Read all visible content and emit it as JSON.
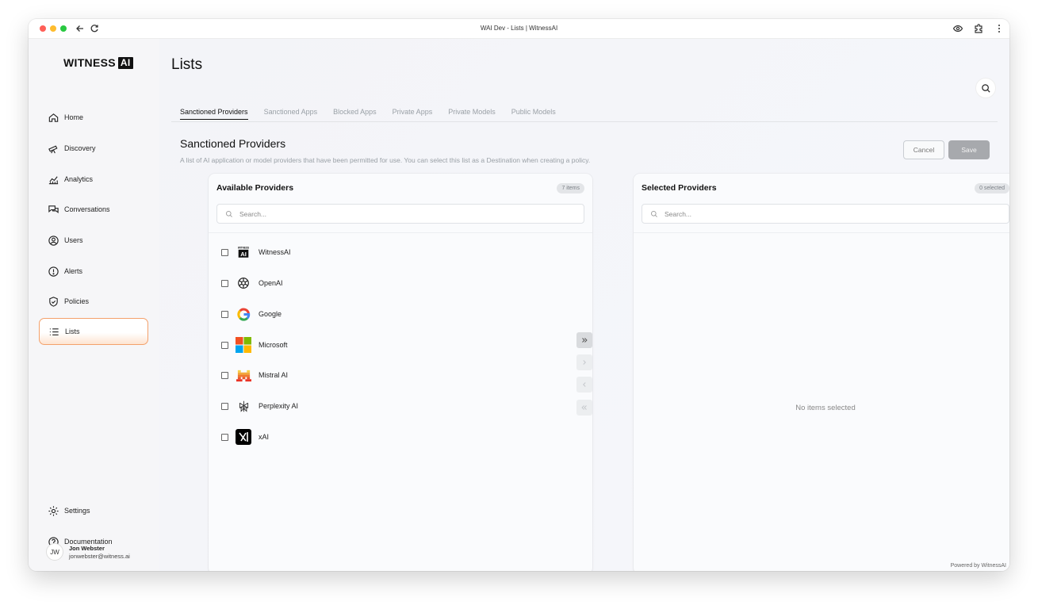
{
  "window": {
    "title": "WAI Dev - Lists | WitnessAI"
  },
  "logo": {
    "text": "WITNESS",
    "box": "AI"
  },
  "sidebar": {
    "items": [
      {
        "label": "Home",
        "icon": "home-icon"
      },
      {
        "label": "Discovery",
        "icon": "telescope-icon"
      },
      {
        "label": "Analytics",
        "icon": "chart-icon"
      },
      {
        "label": "Conversations",
        "icon": "chat-icon"
      },
      {
        "label": "Users",
        "icon": "user-icon"
      },
      {
        "label": "Alerts",
        "icon": "alert-icon"
      },
      {
        "label": "Policies",
        "icon": "shield-icon"
      },
      {
        "label": "Lists",
        "icon": "list-icon",
        "active": true
      },
      {
        "label": "Settings",
        "icon": "gear-icon"
      },
      {
        "label": "Documentation",
        "icon": "help-icon"
      }
    ],
    "user": {
      "initials": "JW",
      "name": "Jon Webster",
      "email": "jonwebster@witness.ai"
    }
  },
  "page": {
    "title": "Lists"
  },
  "tabs": [
    {
      "label": "Sanctioned Providers",
      "active": true
    },
    {
      "label": "Sanctioned Apps"
    },
    {
      "label": "Blocked Apps"
    },
    {
      "label": "Private Apps"
    },
    {
      "label": "Private Models"
    },
    {
      "label": "Public Models"
    }
  ],
  "section": {
    "title": "Sanctioned Providers",
    "description": "A list of AI application or model providers that have been permitted for use. You can select this list as a Destination when creating a policy.",
    "cancel_label": "Cancel",
    "save_label": "Save"
  },
  "available": {
    "title": "Available Providers",
    "count": "7 items",
    "search_placeholder": "Search...",
    "items": [
      "WitnessAI",
      "OpenAI",
      "Google",
      "Microsoft",
      "Mistral AI",
      "Perplexity AI",
      "xAI"
    ]
  },
  "selected": {
    "title": "Selected Providers",
    "count": "0 selected",
    "search_placeholder": "Search...",
    "empty": "No items selected"
  },
  "footer": {
    "powered": "Powered by WitnessAI"
  },
  "colors": {
    "accent": "#f4a16b",
    "save_button": "#a7a9ad"
  }
}
